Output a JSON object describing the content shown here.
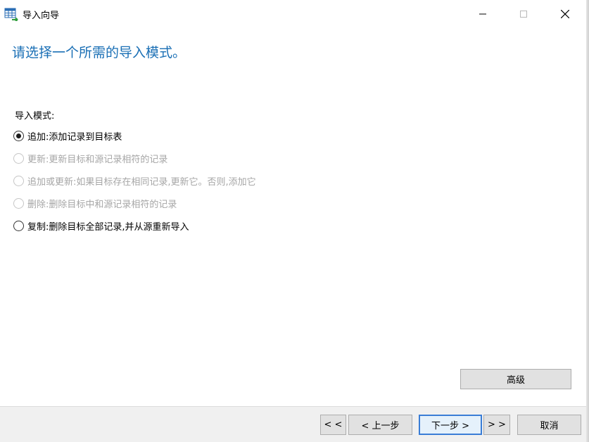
{
  "window": {
    "title": "导入向导",
    "icon": "table-import-icon"
  },
  "content": {
    "heading": "请选择一个所需的导入模式。",
    "mode_label": "导入模式:",
    "options": [
      {
        "label": "追加:添加记录到目标表",
        "checked": true,
        "enabled": true
      },
      {
        "label": "更新:更新目标和源记录相符的记录",
        "checked": false,
        "enabled": false
      },
      {
        "label": "追加或更新:如果目标存在相同记录,更新它。否则,添加它",
        "checked": false,
        "enabled": false
      },
      {
        "label": "删除:删除目标中和源记录相符的记录",
        "checked": false,
        "enabled": false
      },
      {
        "label": "复制:删除目标全部记录,并从源重新导入",
        "checked": false,
        "enabled": true
      }
    ],
    "advanced_label": "高级"
  },
  "footer": {
    "first_label": "< <",
    "prev_label": "< 上一步",
    "next_label": "下一步 >",
    "last_label": "> >",
    "cancel_label": "取消"
  },
  "colors": {
    "heading": "#1a6fb5",
    "default_button_border": "#3a7dd6",
    "disabled_text": "#a6a6a6"
  }
}
